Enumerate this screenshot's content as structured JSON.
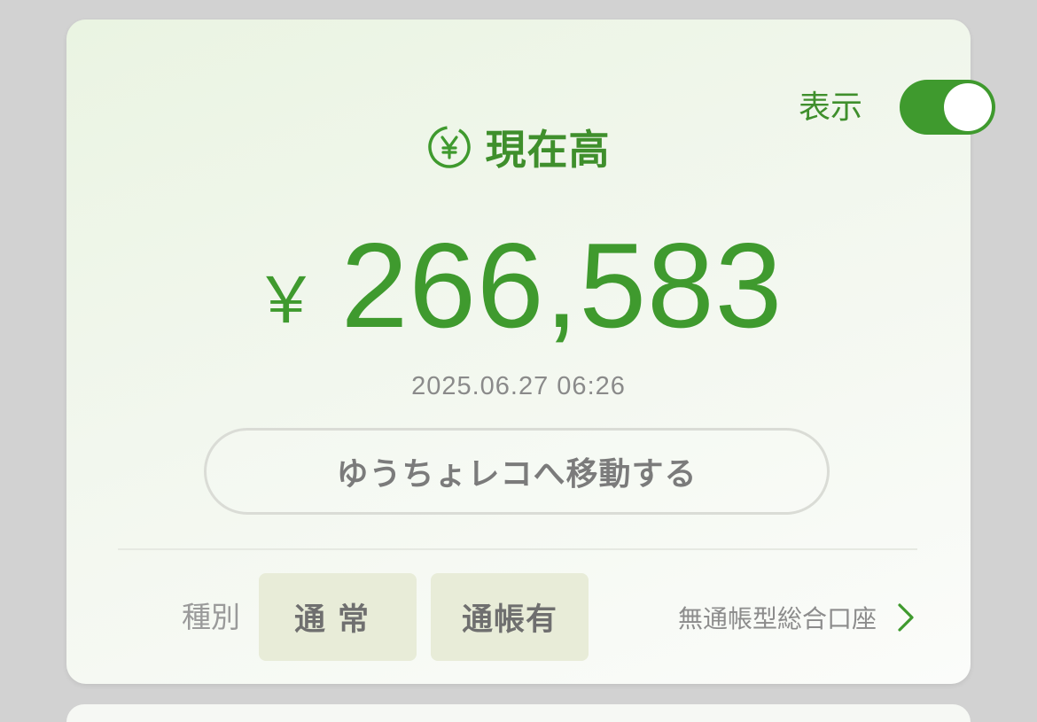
{
  "card": {
    "toggle_label": "表示",
    "toggle_on": true,
    "title": "現在高",
    "currency_symbol": "￥",
    "balance": "266,583",
    "timestamp": "2025.06.27 06:26",
    "move_button_label": "ゆうちょレコへ移動する",
    "type_label": "種別",
    "chips": [
      {
        "label": "通常"
      },
      {
        "label": "通帳有"
      }
    ],
    "account_type_link": "無通帳型総合口座"
  },
  "colors": {
    "accent_green": "#3f9a2e",
    "text_gray": "#8a8a8a",
    "chip_bg": "#e8ecd8"
  },
  "icons": {
    "title_icon": "yen-circle-icon",
    "link_icon": "chevron-right-icon"
  }
}
